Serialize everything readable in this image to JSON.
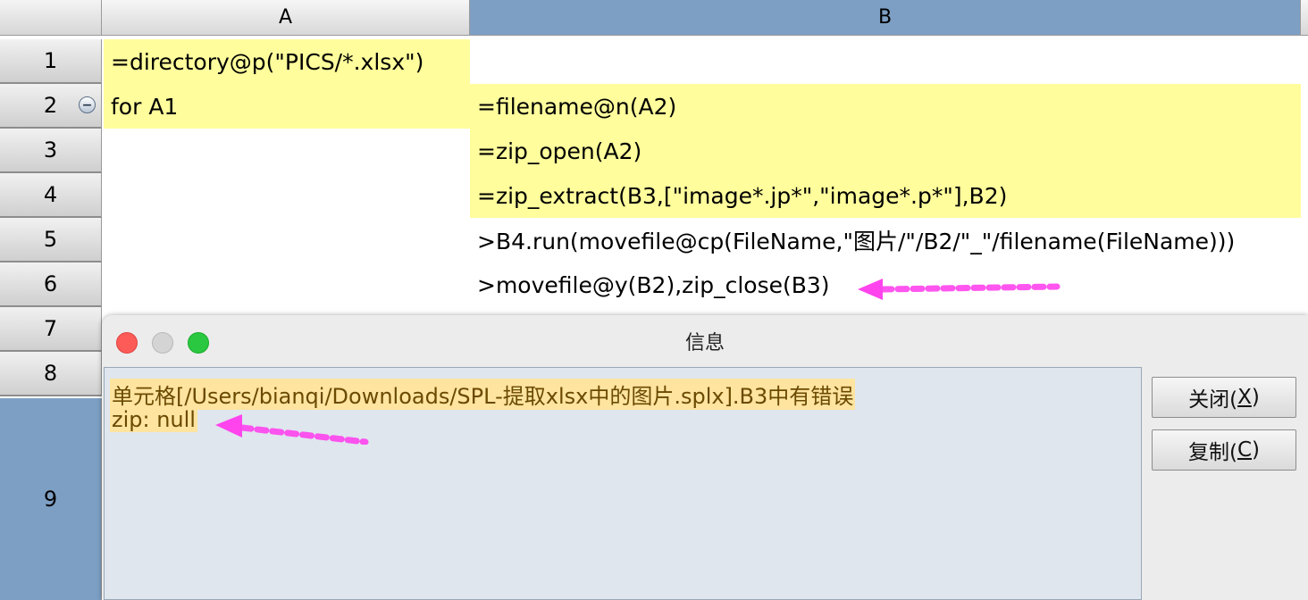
{
  "sheet": {
    "columns": [
      "A",
      "B"
    ],
    "rows": [
      "1",
      "2",
      "3",
      "4",
      "5",
      "6",
      "7",
      "8",
      "9"
    ],
    "cells": {
      "A1": "=directory@p(\"PICS/*.xlsx\")",
      "A2": "for A1",
      "B2": "=filename@n(A2)",
      "B3": "=zip_open(A2)",
      "B4": "=zip_extract(B3,[\"image*.jp*\",\"image*.p*\"],B2)",
      "B5": ">B4.run(movefile@cp(FileName,\"图片/\"/B2/\"_\"/filename(FileName)))",
      "B6": ">movefile@y(B2),zip_close(B3)"
    }
  },
  "dialog": {
    "title": "信息",
    "message_lines": [
      "单元格[/Users/bianqi/Downloads/SPL-提取xlsx中的图片.splx].B3中有错误",
      "zip: null"
    ],
    "buttons": [
      {
        "label": "关闭(",
        "mnemonic": "X",
        "suffix": ")"
      },
      {
        "label": "复制(",
        "mnemonic": "C",
        "suffix": ")"
      }
    ]
  },
  "colors": {
    "highlight_cell": "#fffd9c",
    "selected_header": "#7d9fc4",
    "annotation_arrow": "#ff44ee"
  },
  "icons": [
    "collapse-icon",
    "close-window-icon",
    "minimize-window-icon",
    "zoom-window-icon",
    "arrow-annotation-icon"
  ]
}
